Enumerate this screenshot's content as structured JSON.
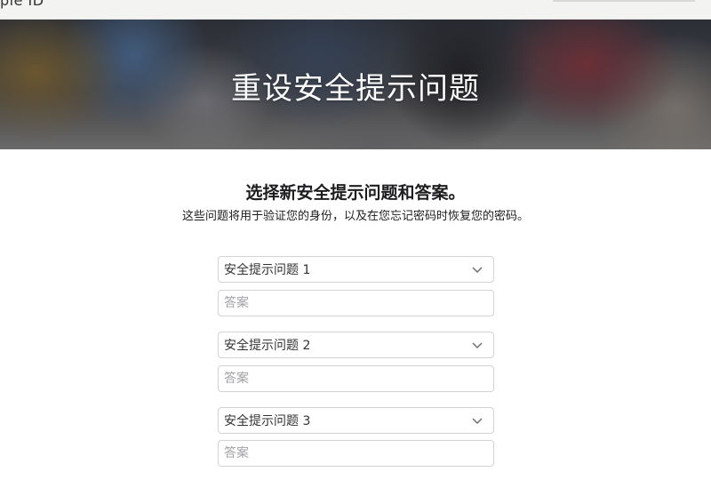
{
  "topbar": {
    "brand_fragment": "ple ID"
  },
  "hero": {
    "title": "重设安全提示问题"
  },
  "main": {
    "heading": "选择新安全提示问题和答案。",
    "description": "这些问题将用于验证您的身份，以及在您忘记密码时恢复您的密码。",
    "questions": [
      {
        "select_label": "安全提示问题 1",
        "answer_placeholder": "答案"
      },
      {
        "select_label": "安全提示问题 2",
        "answer_placeholder": "答案"
      },
      {
        "select_label": "安全提示问题 3",
        "answer_placeholder": "答案"
      }
    ]
  },
  "icons": {
    "select_arrow": "chevron-down-icon"
  }
}
